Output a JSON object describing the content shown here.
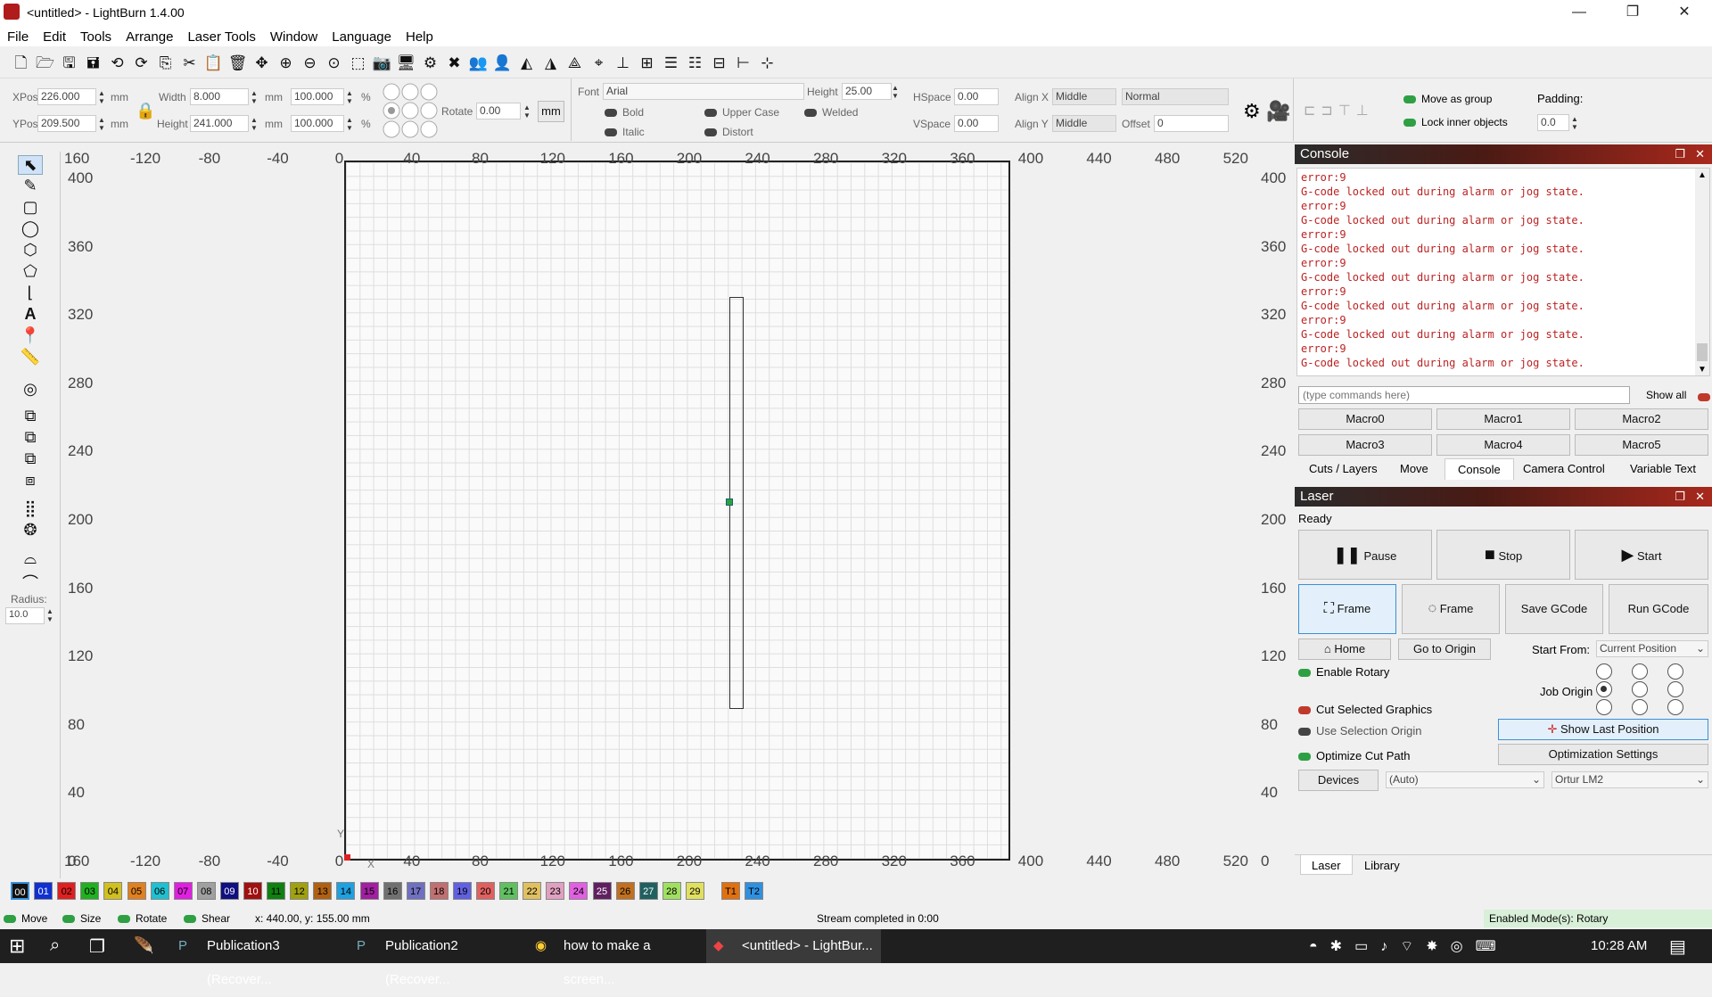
{
  "window": {
    "title": "<untitled> - LightBurn 1.4.00",
    "minimize": "—",
    "restore": "❐",
    "close": "✕"
  },
  "menu": [
    "File",
    "Edit",
    "Tools",
    "Arrange",
    "Laser Tools",
    "Window",
    "Language",
    "Help"
  ],
  "props": {
    "xpos_label": "XPos",
    "xpos": "226.000",
    "ypos_label": "YPos",
    "ypos": "209.500",
    "mm": "mm",
    "width_label": "Width",
    "width": "8.000",
    "height_label": "Height",
    "height": "241.000",
    "pct_w": "100.000",
    "pct_h": "100.000",
    "pct": "%",
    "rotate_label": "Rotate",
    "rotate": "0.00",
    "unit_btn": "mm",
    "font_label": "Font",
    "font": "Arial",
    "fheight_label": "Height",
    "fheight": "25.00",
    "hspace_label": "HSpace",
    "hspace": "0.00",
    "vspace_label": "VSpace",
    "vspace": "0.00",
    "alignx_label": "Align X",
    "alignx": "Middle",
    "aligny_label": "Align Y",
    "aligny": "Middle",
    "normal": "Normal",
    "offset_label": "Offset",
    "offset": "0",
    "bold": "Bold",
    "italic": "Italic",
    "upper": "Upper Case",
    "distort": "Distort",
    "welded": "Welded",
    "move_group": "Move as group",
    "lock_inner": "Lock inner objects",
    "padding_label": "Padding:",
    "padding": "0.0"
  },
  "rulers": {
    "top": [
      "160",
      "-120",
      "-80",
      "-40",
      "0",
      "40",
      "80",
      "120",
      "160",
      "200",
      "240",
      "280",
      "320",
      "360",
      "400",
      "440",
      "480",
      "520"
    ],
    "left": [
      "400",
      "360",
      "320",
      "280",
      "240",
      "200",
      "160",
      "120",
      "80",
      "40",
      "0"
    ],
    "radius_label": "Radius:",
    "radius": "10.0",
    "y_axis": "Y",
    "x_axis": "X"
  },
  "palette": [
    "00",
    "01",
    "02",
    "03",
    "04",
    "05",
    "06",
    "07",
    "08",
    "09",
    "10",
    "11",
    "12",
    "13",
    "14",
    "15",
    "16",
    "17",
    "18",
    "19",
    "20",
    "21",
    "22",
    "23",
    "24",
    "25",
    "26",
    "27",
    "28",
    "29",
    "T1",
    "T2"
  ],
  "palette_colors": [
    "#111111",
    "#1030d0",
    "#e02020",
    "#20b020",
    "#d0c020",
    "#e08020",
    "#20c0d0",
    "#e020e0",
    "#a0a0a0",
    "#101080",
    "#a01010",
    "#108010",
    "#a0a010",
    "#b06010",
    "#20a0e0",
    "#a020a0",
    "#707070",
    "#7070c0",
    "#c07070",
    "#6060e0",
    "#e06060",
    "#60c060",
    "#e0c060",
    "#e0a0c0",
    "#e060e0",
    "#602060",
    "#c07020",
    "#206060",
    "#a0e060",
    "#e0e060",
    "#e07010",
    "#3090e0"
  ],
  "console": {
    "title": "Console",
    "lines": [
      "error:9",
      "G-code locked out during alarm or jog state.",
      "error:9",
      "G-code locked out during alarm or jog state.",
      "error:9",
      "G-code locked out during alarm or jog state.",
      "error:9",
      "G-code locked out during alarm or jog state.",
      "error:9",
      "G-code locked out during alarm or jog state.",
      "error:9",
      "G-code locked out during alarm or jog state.",
      "error:9",
      "G-code locked out during alarm or jog state."
    ],
    "placeholder": "(type commands here)",
    "show_all": "Show all",
    "macros": [
      "Macro0",
      "Macro1",
      "Macro2",
      "Macro3",
      "Macro4",
      "Macro5"
    ],
    "tabs": [
      "Cuts / Layers",
      "Move",
      "Console",
      "Camera Control",
      "Variable Text"
    ]
  },
  "laser": {
    "title": "Laser",
    "status": "Ready",
    "pause": "Pause",
    "stop": "Stop",
    "start": "Start",
    "frame1": "Frame",
    "frame2": "Frame",
    "save_gcode": "Save GCode",
    "run_gcode": "Run GCode",
    "home": "Home",
    "go_origin": "Go to Origin",
    "start_from_label": "Start From:",
    "start_from": "Current Position",
    "enable_rotary": "Enable Rotary",
    "job_origin": "Job Origin",
    "cut_selected": "Cut Selected Graphics",
    "use_selection": "Use Selection Origin",
    "show_last": "Show Last Position",
    "optimize": "Optimize Cut Path",
    "opt_settings": "Optimization Settings",
    "devices": "Devices",
    "auto": "(Auto)",
    "device": "Ortur LM2",
    "tabs": [
      "Laser",
      "Library"
    ]
  },
  "status": {
    "move": "Move",
    "size": "Size",
    "rotate": "Rotate",
    "shear": "Shear",
    "coords": "x: 440.00, y: 155.00 mm",
    "stream": "Stream completed in 0:00",
    "modes": "Enabled Mode(s): Rotary"
  },
  "taskbar": {
    "items": [
      "Publication3 (Recover...",
      "Publication2 (Recover...",
      "how to make a screen...",
      "<untitled> - LightBur..."
    ],
    "time": "10:28 AM"
  }
}
